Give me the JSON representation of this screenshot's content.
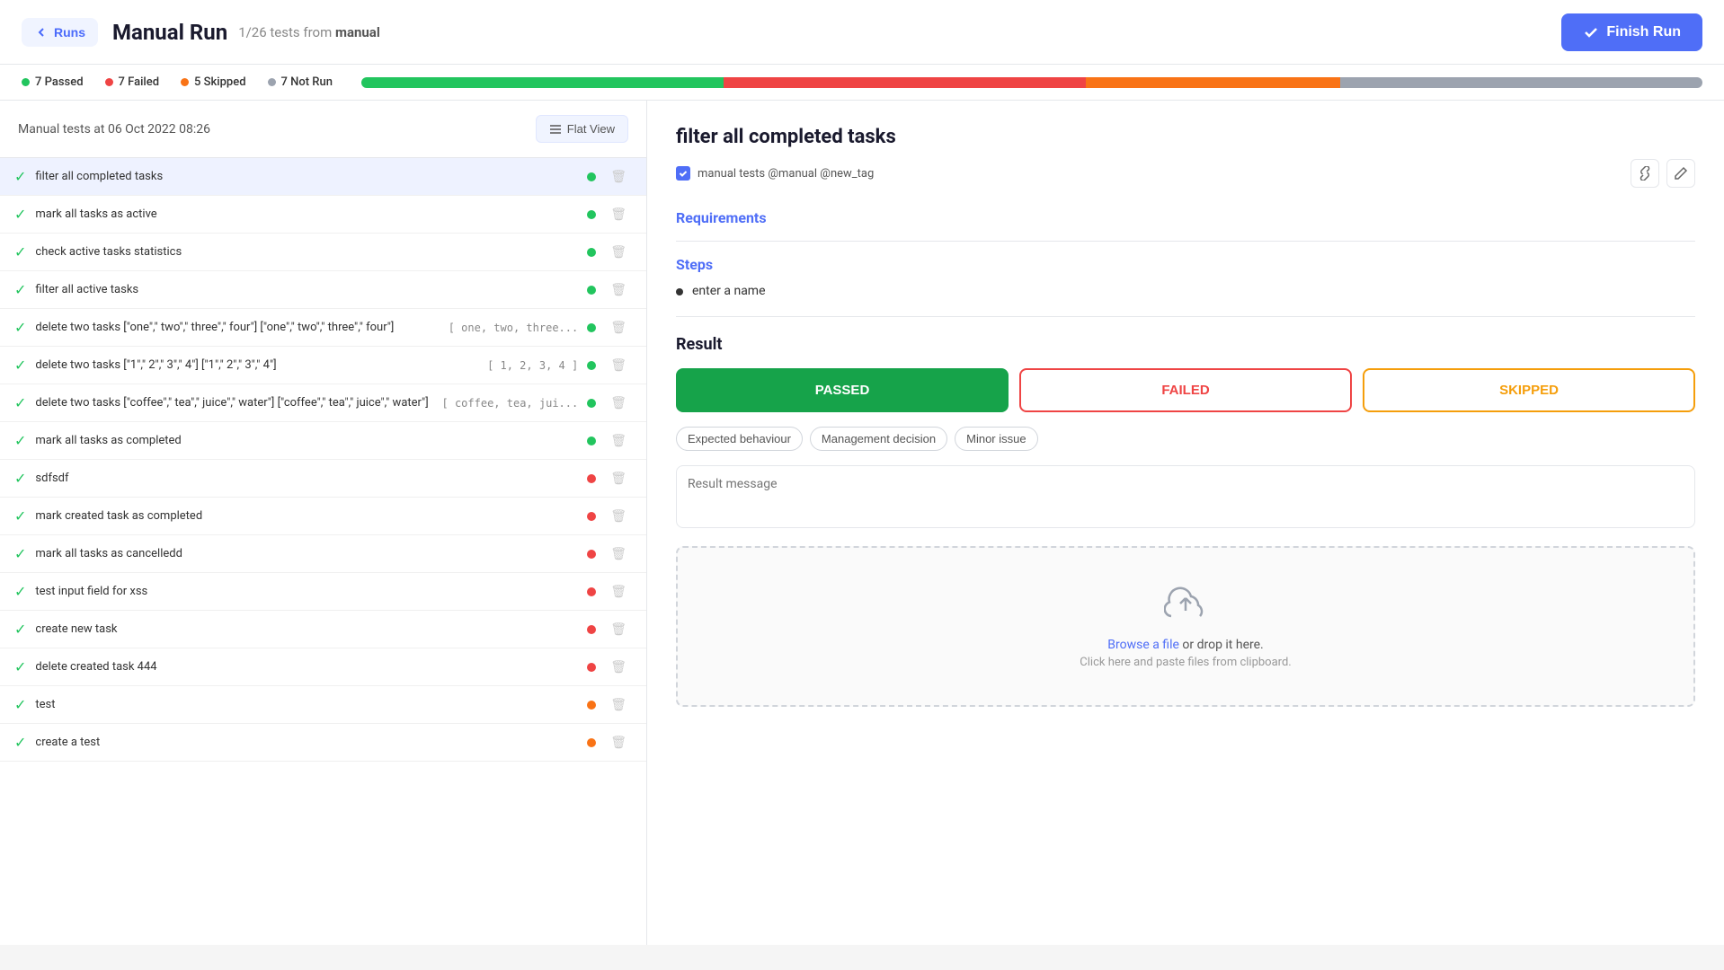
{
  "header": {
    "back_label": "Runs",
    "title": "Manual Run",
    "subtitle": "1/26 tests from",
    "subtitle_bold": "manual",
    "finish_label": "Finish Run"
  },
  "stats": {
    "passed_count": "7 Passed",
    "failed_count": "7 Failed",
    "skipped_count": "5 Skipped",
    "not_run_count": "7 Not Run",
    "progress": {
      "passed_pct": 27,
      "failed_pct": 27,
      "skipped_pct": 19,
      "not_run_pct": 27
    }
  },
  "panel": {
    "title": "Manual tests at 06 Oct 2022 08:26",
    "view_label": "Flat View"
  },
  "tests": [
    {
      "id": 1,
      "name": "filter all completed tasks",
      "params": "",
      "status": "green",
      "selected": true
    },
    {
      "id": 2,
      "name": "mark all tasks as active",
      "params": "",
      "status": "green",
      "selected": false
    },
    {
      "id": 3,
      "name": "check active tasks statistics",
      "params": "",
      "status": "green",
      "selected": false
    },
    {
      "id": 4,
      "name": "filter all active tasks",
      "params": "",
      "status": "green",
      "selected": false
    },
    {
      "id": 5,
      "name": "delete two tasks [\"one\",\" two\",\" three\",\" four\"] [\"one\",\" two\",\" three\",\" four\"]",
      "params": "[ one, two, three...",
      "status": "green",
      "selected": false
    },
    {
      "id": 6,
      "name": "delete two tasks [\"1\",\" 2\",\" 3\",\" 4\"] [\"1\",\" 2\",\" 3\",\" 4\"]",
      "params": "[ 1, 2, 3, 4 ]",
      "status": "green",
      "selected": false
    },
    {
      "id": 7,
      "name": "delete two tasks [\"coffee\",\" tea\",\" juice\",\" water\"] [\"coffee\",\" tea\",\" juice\",\" water\"]",
      "params": "[ coffee, tea, jui...",
      "status": "green",
      "selected": false
    },
    {
      "id": 8,
      "name": "mark all tasks as completed",
      "params": "",
      "status": "green",
      "selected": false
    },
    {
      "id": 9,
      "name": "sdfsdf",
      "params": "",
      "status": "red",
      "selected": false
    },
    {
      "id": 10,
      "name": "mark created task as completed",
      "params": "",
      "status": "red",
      "selected": false
    },
    {
      "id": 11,
      "name": "mark all tasks as cancelledd",
      "params": "",
      "status": "red",
      "selected": false
    },
    {
      "id": 12,
      "name": "test input field for xss",
      "params": "",
      "status": "red",
      "selected": false
    },
    {
      "id": 13,
      "name": "create new task",
      "params": "",
      "status": "red",
      "selected": false
    },
    {
      "id": 14,
      "name": "delete created task 444",
      "params": "",
      "status": "red",
      "selected": false
    },
    {
      "id": 15,
      "name": "test",
      "params": "",
      "status": "orange",
      "selected": false
    },
    {
      "id": 16,
      "name": "create a test",
      "params": "",
      "status": "orange",
      "selected": false
    }
  ],
  "detail": {
    "title": "filter all completed tasks",
    "meta": "manual tests @manual @new_tag",
    "requirements_label": "Requirements",
    "steps_label": "Steps",
    "steps": [
      {
        "text": "enter a name"
      }
    ],
    "result_label": "Result",
    "passed_label": "PASSED",
    "failed_label": "FAILED",
    "skipped_label": "SKIPPED",
    "tags": [
      "Expected behaviour",
      "Management decision",
      "Minor issue"
    ],
    "message_placeholder": "Result message",
    "upload_link": "Browse a file",
    "upload_text": " or drop it here.",
    "upload_subtext": "Click here and paste files from clipboard."
  }
}
